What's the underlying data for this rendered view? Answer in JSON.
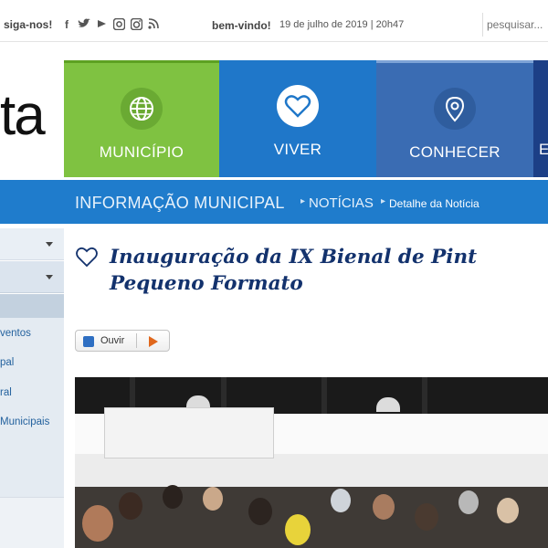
{
  "topbar": {
    "follow_label": "siga-nos!",
    "social_icons": [
      "facebook-icon",
      "twitter-icon",
      "youtube-icon",
      "flickr-icon",
      "instagram-icon",
      "rss-icon"
    ],
    "welcome": "bem-vindo!",
    "date": "19 de julho de 2019 | 20h47",
    "search_placeholder": "pesquisar..."
  },
  "logo": {
    "text": "ta"
  },
  "nav": {
    "tiles": [
      {
        "label": "MUNICÍPIO",
        "icon": "globe-icon",
        "color": "#7fc241"
      },
      {
        "label": "VIVER",
        "icon": "heart-icon",
        "color": "#1f77c9"
      },
      {
        "label": "CONHECER",
        "icon": "location-pin-icon",
        "color": "#3a6cb3"
      },
      {
        "label": "E",
        "icon": "",
        "color": "#1c3f86"
      }
    ]
  },
  "breadcrumb": {
    "level1": "INFORMAÇÃO MUNICIPAL",
    "level2": "NOTÍCIAS",
    "level3": "Detalhe da Notícia",
    "separator": "▸"
  },
  "sidebar": {
    "links": [
      "ventos",
      "pal",
      "ral",
      "Municipais"
    ]
  },
  "article": {
    "title_line1": "Inauguração da IX Bienal de Pint",
    "title_line2": "Pequeno Formato",
    "listen_label": "Ouvir"
  },
  "colors": {
    "accent_blue": "#1f7ccc",
    "title_navy": "#13326d",
    "green": "#7fc241"
  }
}
